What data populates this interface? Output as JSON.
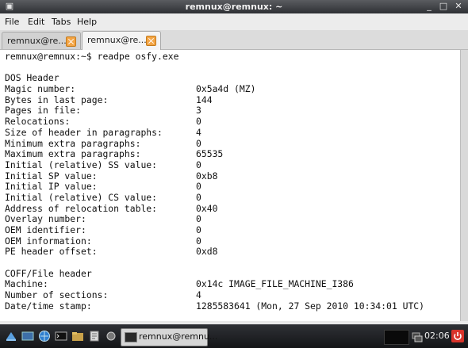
{
  "window": {
    "title": "remnux@remnux: ~"
  },
  "menu": [
    "File",
    "Edit",
    "Tabs",
    "Help"
  ],
  "tabs": [
    {
      "label": "remnux@re..."
    },
    {
      "label": "remnux@re..."
    }
  ],
  "terminal": {
    "prompt": "remnux@remnux:~$ readpe osfy.exe",
    "dos_header": {
      "title": "DOS Header",
      "rows": [
        {
          "key": "Magic number:",
          "value": "0x5a4d (MZ)"
        },
        {
          "key": "Bytes in last page:",
          "value": "144"
        },
        {
          "key": "Pages in file:",
          "value": "3"
        },
        {
          "key": "Relocations:",
          "value": "0"
        },
        {
          "key": "Size of header in paragraphs:",
          "value": "4"
        },
        {
          "key": "Minimum extra paragraphs:",
          "value": "0"
        },
        {
          "key": "Maximum extra paragraphs:",
          "value": "65535"
        },
        {
          "key": "Initial (relative) SS value:",
          "value": "0"
        },
        {
          "key": "Initial SP value:",
          "value": "0xb8"
        },
        {
          "key": "Initial IP value:",
          "value": "0"
        },
        {
          "key": "Initial (relative) CS value:",
          "value": "0"
        },
        {
          "key": "Address of relocation table:",
          "value": "0x40"
        },
        {
          "key": "Overlay number:",
          "value": "0"
        },
        {
          "key": "OEM identifier:",
          "value": "0"
        },
        {
          "key": "OEM information:",
          "value": "0"
        },
        {
          "key": "PE header offset:",
          "value": "0xd8"
        }
      ]
    },
    "coff_header": {
      "title": "COFF/File header",
      "rows": [
        {
          "key": "Machine:",
          "value": "0x14c IMAGE_FILE_MACHINE_I386"
        },
        {
          "key": "Number of sections:",
          "value": "4"
        },
        {
          "key": "Date/time stamp:",
          "value": "1285583641 (Mon, 27 Sep 2010 10:34:01 UTC)"
        }
      ]
    }
  },
  "taskbar": {
    "task_label": "remnux@remnu...",
    "clock": "02:06"
  },
  "colors": {
    "titlebar": "#3a3c40",
    "terminal_bg": "#ffffff",
    "tab_close": "#f3a545",
    "power_button": "#d9342b"
  }
}
